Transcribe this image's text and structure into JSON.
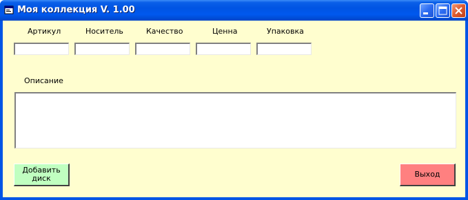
{
  "window": {
    "title": "Моя коллекция V. 1.00",
    "controls": {
      "minimize": "minimize-icon",
      "maximize": "maximize-icon",
      "close": "close-icon"
    }
  },
  "form": {
    "fields": [
      {
        "label": "Артикул",
        "value": ""
      },
      {
        "label": "Носитель",
        "value": ""
      },
      {
        "label": "Качество",
        "value": ""
      },
      {
        "label": "Ценна",
        "value": ""
      },
      {
        "label": "Упаковка",
        "value": ""
      }
    ],
    "description": {
      "label": "Описание",
      "value": ""
    }
  },
  "buttons": {
    "add_disc": "Добавить\nдиск",
    "exit": "Выход"
  },
  "colors": {
    "titlebar": "#0054e3",
    "client_background": "#fffecf",
    "add_button": "#c0ffc0",
    "exit_button": "#ff8080"
  }
}
